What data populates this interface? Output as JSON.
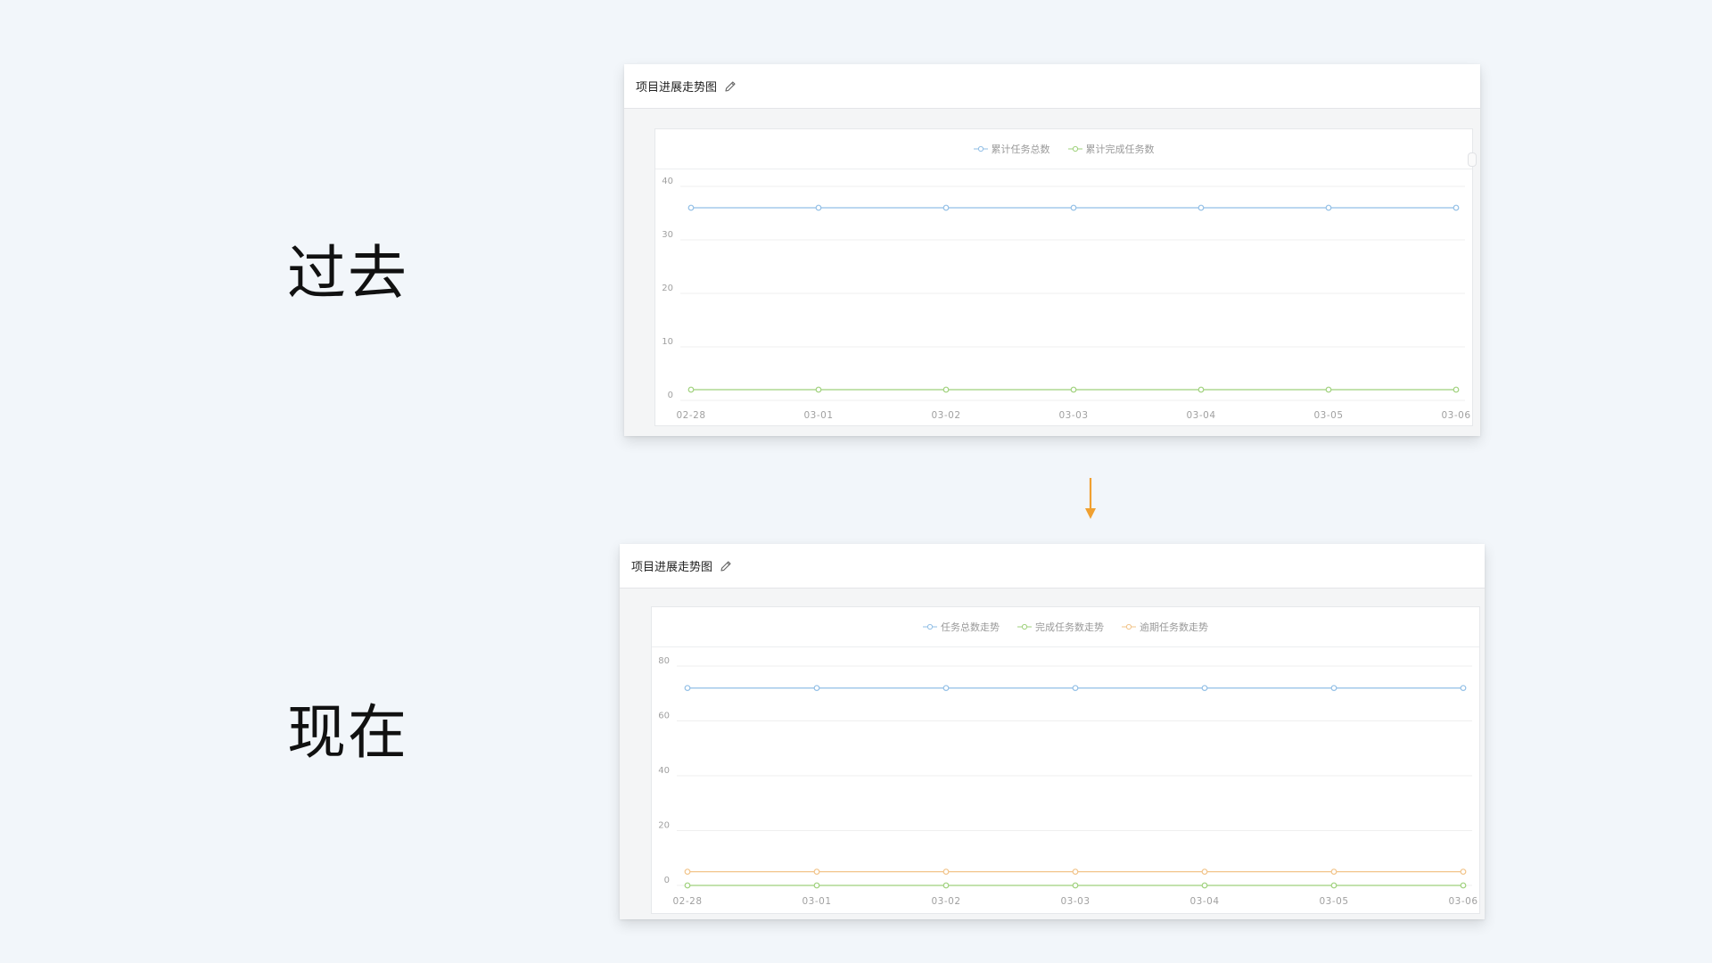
{
  "labels": {
    "past": "过去",
    "now": "现在"
  },
  "colors": {
    "blue": "#92bfe6",
    "green": "#9fd17c",
    "orange": "#f2c48a",
    "arrow": "#f0a030",
    "grid": "#efefef",
    "axis_text": "#a0a0a0"
  },
  "cards": [
    {
      "title": "项目进展走势图",
      "edit_icon": "pencil-icon",
      "chart_data": {
        "type": "line",
        "categories": [
          "02-28",
          "03-01",
          "03-02",
          "03-03",
          "03-04",
          "03-05",
          "03-06"
        ],
        "ylim": [
          0,
          40
        ],
        "yticks": [
          0,
          10,
          20,
          30,
          40
        ],
        "grid": true,
        "legend_position": "top-center",
        "series": [
          {
            "name": "累计任务总数",
            "color": "#92bfe6",
            "values": [
              36,
              36,
              36,
              36,
              36,
              36,
              36
            ]
          },
          {
            "name": "累计完成任务数",
            "color": "#9fd17c",
            "values": [
              2,
              2,
              2,
              2,
              2,
              2,
              2
            ]
          }
        ]
      }
    },
    {
      "title": "项目进展走势图",
      "edit_icon": "pencil-icon",
      "chart_data": {
        "type": "line",
        "categories": [
          "02-28",
          "03-01",
          "03-02",
          "03-03",
          "03-04",
          "03-05",
          "03-06"
        ],
        "ylim": [
          0,
          80
        ],
        "yticks": [
          0,
          20,
          40,
          60,
          80
        ],
        "grid": true,
        "legend_position": "top-center",
        "series": [
          {
            "name": "任务总数走势",
            "color": "#92bfe6",
            "values": [
              72,
              72,
              72,
              72,
              72,
              72,
              72
            ]
          },
          {
            "name": "完成任务数走势",
            "color": "#9fd17c",
            "values": [
              0,
              0,
              0,
              0,
              0,
              0,
              0
            ]
          },
          {
            "name": "逾期任务数走势",
            "color": "#f2c48a",
            "values": [
              5,
              5,
              5,
              5,
              5,
              5,
              5
            ]
          }
        ]
      }
    }
  ]
}
